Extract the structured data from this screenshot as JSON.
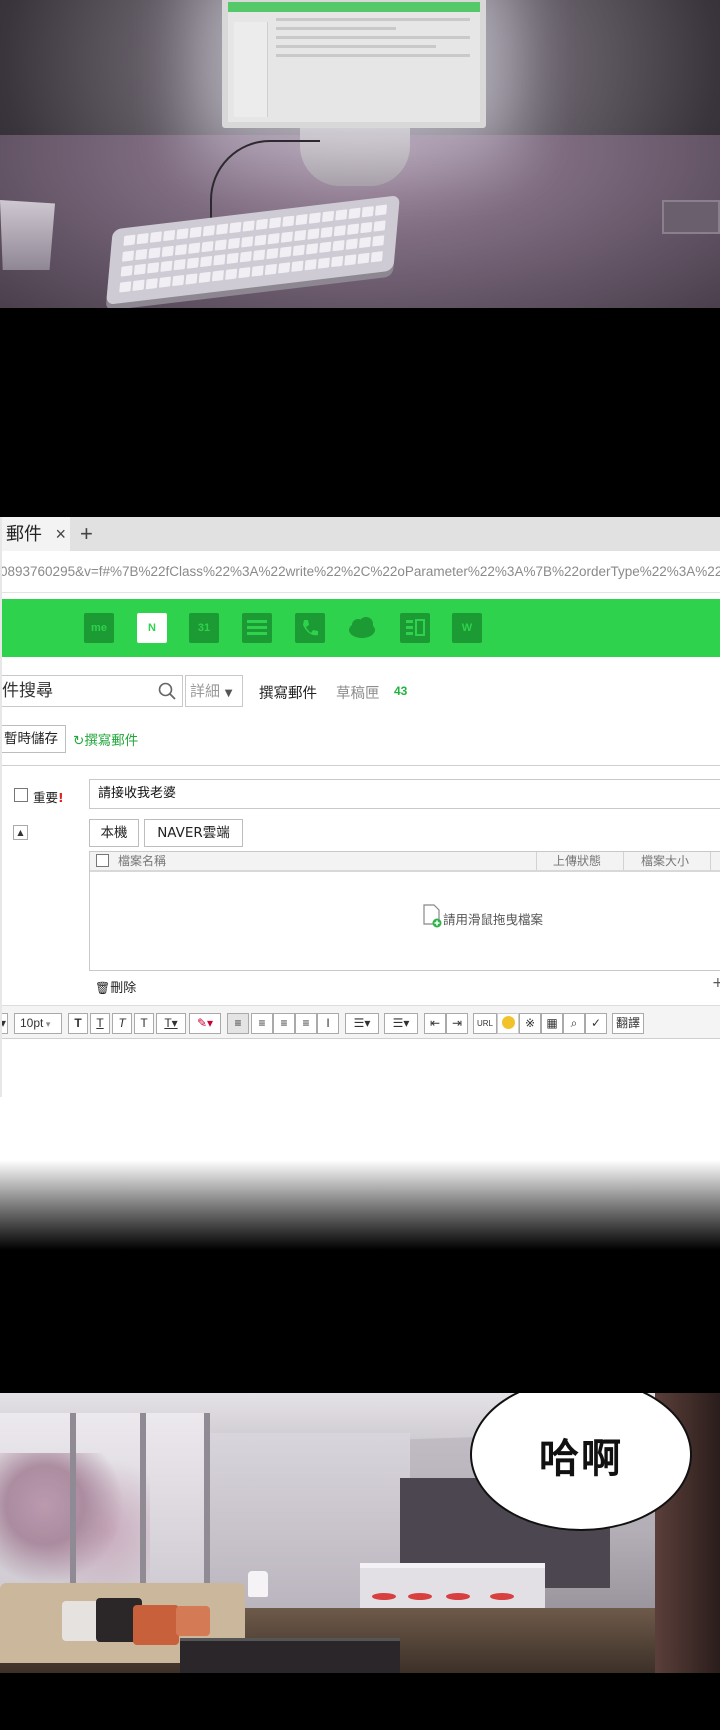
{
  "browser": {
    "tab_title": "郵件",
    "tab_close": "×",
    "new_tab": "+",
    "url": "0893760295&v=f#%7B%22fClass%22%3A%22write%22%2C%22oParameter%22%3A%7B%22orderType%22%3A%22to"
  },
  "gnb": {
    "icons": [
      {
        "name": "me-icon",
        "label": "me"
      },
      {
        "name": "mail-icon",
        "label": "N",
        "active": true
      },
      {
        "name": "calendar-icon",
        "label": "31"
      },
      {
        "name": "list-icon",
        "label": ""
      },
      {
        "name": "phone-icon",
        "label": ""
      },
      {
        "name": "cloud-icon",
        "label": ""
      },
      {
        "name": "memo-icon",
        "label": ""
      },
      {
        "name": "home-icon",
        "label": "W"
      }
    ],
    "color": "#2fd24c"
  },
  "search": {
    "placeholder": "件搜尋",
    "detail_label": "詳細"
  },
  "nav": {
    "compose": "撰寫郵件",
    "drafts": "草稿匣",
    "drafts_count": "43"
  },
  "actions": {
    "save_draft": "暫時儲存",
    "compose_link": "撰寫郵件"
  },
  "form": {
    "important_label": "重要",
    "important_mark": "!",
    "subject": "請接收我老婆",
    "source_local": "本機",
    "source_cloud": "NAVER雲端",
    "columns": {
      "name": "檔案名稱",
      "status": "上傳狀態",
      "size": "檔案大小"
    },
    "dropzone": "請用滑鼠拖曳檔案",
    "delete": "刪除"
  },
  "toolbar": {
    "font_size": "10pt",
    "translate": "翻譯",
    "url_button": "URL"
  },
  "speech": {
    "text": "哈啊"
  }
}
